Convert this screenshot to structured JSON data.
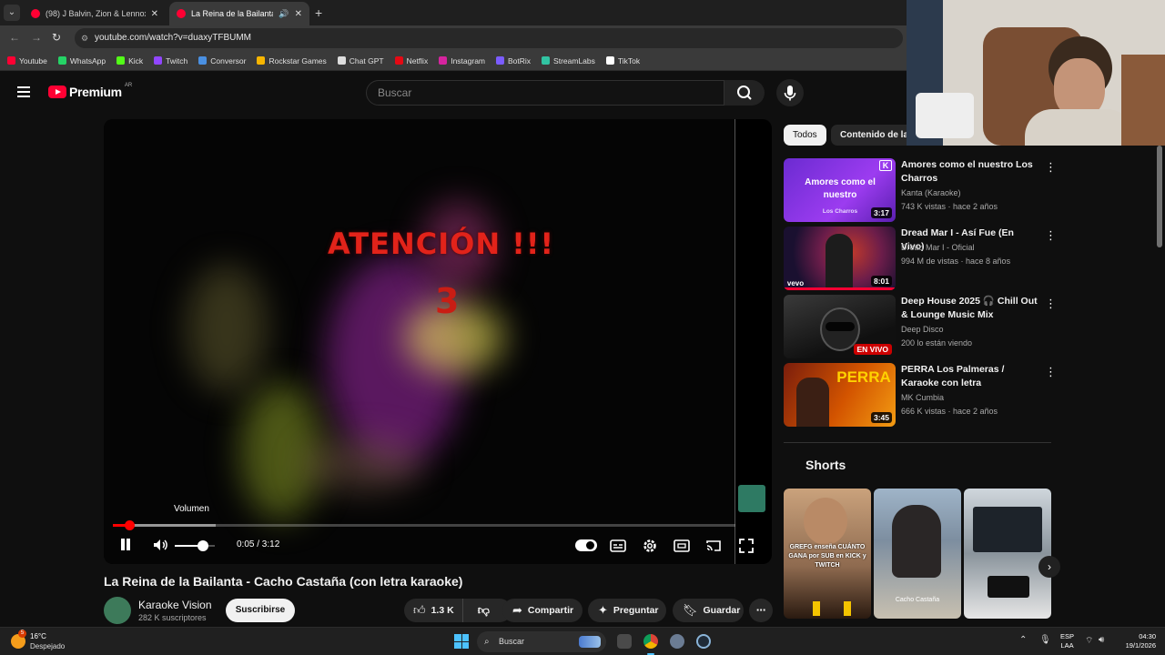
{
  "browser": {
    "tabs": [
      {
        "title": "(98) J Balvin, Zion & Lennox - M",
        "active": false
      },
      {
        "title": "La Reina de la Bailanta - Ca",
        "active": true
      }
    ],
    "url": "youtube.com/watch?v=duaxyTFBUMM",
    "bookmarks": [
      {
        "label": "Youtube",
        "color": "#ff0033"
      },
      {
        "label": "WhatsApp",
        "color": "#25d366"
      },
      {
        "label": "Kick",
        "color": "#53fc18"
      },
      {
        "label": "Twitch",
        "color": "#9146ff"
      },
      {
        "label": "Conversor",
        "color": "#4a90e2"
      },
      {
        "label": "Rockstar Games",
        "color": "#f7b500"
      },
      {
        "label": "Chat GPT",
        "color": "#dddddd"
      },
      {
        "label": "Netflix",
        "color": "#e50914"
      },
      {
        "label": "Instagram",
        "color": "#d6249f"
      },
      {
        "label": "BotRix",
        "color": "#7b5cff"
      },
      {
        "label": "StreamLabs",
        "color": "#31c3a2"
      },
      {
        "label": "TikTok",
        "color": "#ffffff"
      }
    ]
  },
  "header": {
    "logo_text": "Premium",
    "country": "AR",
    "search_placeholder": "Buscar"
  },
  "player": {
    "overlay_title": "ATENCIÓN !!!",
    "countdown": "3",
    "tooltip": "Volumen",
    "current_time": "0:05",
    "duration": "3:12",
    "time_display": "0:05 / 3:12",
    "progress_fraction": 0.027,
    "buffered_fraction": 0.165,
    "volume_fraction": 0.7
  },
  "video": {
    "title": "La Reina de la Bailanta - Cacho Castaña (con letra karaoke)",
    "channel": "Karaoke Vision",
    "subscribers": "282 K suscriptores",
    "subscribe_label": "Suscribirse",
    "likes": "1.3 K",
    "share_label": "Compartir",
    "ask_label": "Preguntar",
    "save_label": "Guardar"
  },
  "sidebar": {
    "chips": [
      "Todos",
      "Contenido de la"
    ],
    "recommendations": [
      {
        "title": "Amores como el nuestro   Los Charros",
        "channel": "Kanta (Karaoke)",
        "meta": "743 K vistas · hace 2 años",
        "duration": "3:17",
        "thumb_text": "Amores como el nuestro",
        "thumb_sub": "Los Charros",
        "thumb_logo": "K"
      },
      {
        "title": "Dread Mar I - Así Fue (En Vivo)",
        "channel": "Dread Mar I - Oficial",
        "meta": "994 M de vistas · hace 8 años",
        "duration": "8:01",
        "thumb_logo": "vevo"
      },
      {
        "title": "Deep House 2025 🎧 Chill Out & Lounge Music Mix",
        "channel": "Deep Disco",
        "meta": "200 lo están viendo",
        "live": "EN VIVO"
      },
      {
        "title": "PERRA Los Palmeras / Karaoke con letra",
        "channel": "MK Cumbia",
        "meta": "666 K vistas · hace 2 años",
        "duration": "3:45",
        "thumb_text": "PERRA"
      }
    ],
    "shorts_heading": "Shorts",
    "shorts": [
      {
        "caption": "GREFG enseña CUÁNTO GANA por SUB en KICK y TWITCH"
      },
      {
        "caption": "Cacho Castaña"
      },
      {
        "caption": ""
      }
    ]
  },
  "taskbar": {
    "temperature": "16°C",
    "weather": "Despejado",
    "weather_badge": "5",
    "search_label": "Buscar",
    "lang_line1": "ESP",
    "lang_line2": "LAA",
    "time": "04:30",
    "date": "19/1/2026"
  }
}
